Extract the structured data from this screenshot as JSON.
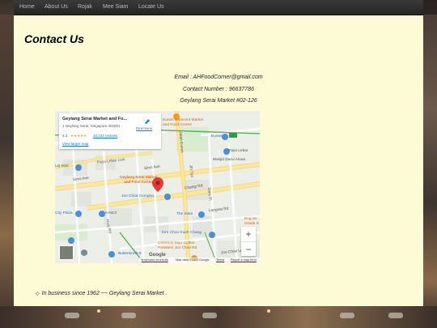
{
  "nav": {
    "items": [
      "Home",
      "About Us",
      "Rojak",
      "Mee Siam",
      "Locate Us"
    ]
  },
  "page": {
    "title": "Contact Us",
    "email": "Email : AHFoodCorner@gmail.com",
    "contact_number": "Contact Number : 96637786",
    "address": "Geylang Serai Market #02-126",
    "footer_text": "In business since 1962 ~~ Geylang Serai Market .",
    "footer_bullet": "◇"
  },
  "map": {
    "card": {
      "place_name": "Geylang Serai Market and Fo...",
      "address": "1 Geylang Serai, Singapore 402001",
      "rating": "4.3",
      "stars": "★★★★★",
      "reviews": "10,232 reviews",
      "view_larger": "View larger map",
      "directions": "Directions"
    },
    "zoom_in": "+",
    "zoom_out": "−",
    "google_logo": "Google",
    "attribution": {
      "shortcuts": "Keyboard shortcuts",
      "map_data": "Map data ©2023 Google",
      "terms": "Terms",
      "report": "Report a map error"
    },
    "labels": {
      "market": "Geylang Serai Market\nand Food Centre",
      "eunos_crescent": "Eunos Crescent Market\nand Food Centre",
      "eunos_mrt": "Eunos",
      "paya_lebar_link": "Paya Lebar Link",
      "paya_lebar_mrt": "Paya Lebar",
      "lo_mall": "LQ Mall",
      "sims_ave": "Sims Ave",
      "sims_ave_2": "Sims Ave",
      "masjid": "Masjid Darul Aman",
      "joo_chiat_complex": "Joo Chiat Complex",
      "city_plaza": "City Plaza",
      "kinex": "KINEX",
      "changi_rd": "Changi Rd",
      "the_intan": "The Intan",
      "langsat_rd": "Langsat Rd",
      "eng_seng": "Eng Se\nGrade S",
      "kim_choo": "Kim Choo Kueh Chang",
      "common_man": "Common Man Coffee\nRoasters Joo Chiat Rd",
      "butterworth": "Butterworth 8",
      "joo_chiat_ln": "Joo Chiat Ln",
      "jalan_eunos": "Jalan Eunos",
      "jln_turi": "Jln Turi",
      "sims_pl": "Sims Pl",
      "haig_rd": "Haig Rd"
    }
  },
  "colors": {
    "nav_bg": "#252525",
    "nav_text": "#bbbbbb",
    "content_bg": "#fdfbd6",
    "map_pin": "#e53935",
    "link_blue": "#1a73e8"
  }
}
